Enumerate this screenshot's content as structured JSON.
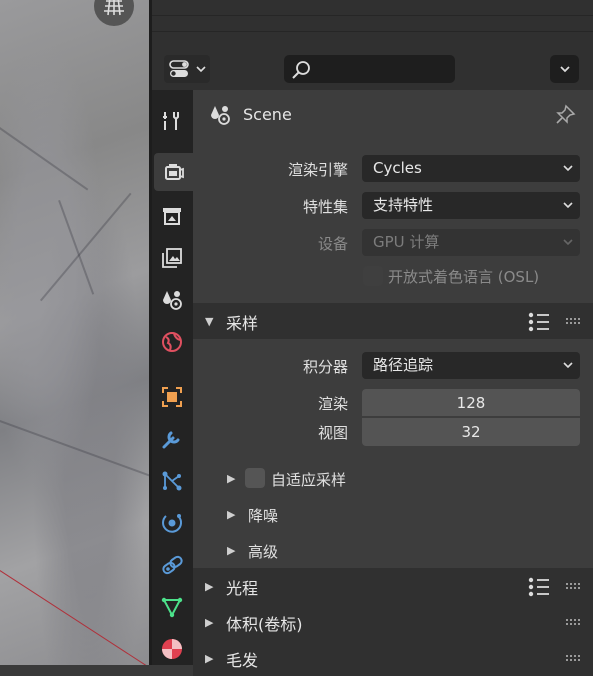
{
  "header": {
    "search_placeholder": ""
  },
  "tabs": [
    {
      "name": "tool",
      "icon": "tool-icon",
      "color": "#dcdcdc"
    },
    {
      "name": "render",
      "icon": "render-icon",
      "color": "#dcdcdc",
      "active": true
    },
    {
      "name": "output",
      "icon": "output-icon",
      "color": "#dcdcdc"
    },
    {
      "name": "view-layer",
      "icon": "view-layer-icon",
      "color": "#dcdcdc"
    },
    {
      "name": "scene",
      "icon": "scene-icon",
      "color": "#dcdcdc"
    },
    {
      "name": "world",
      "icon": "world-icon",
      "color": "#e05060"
    },
    {
      "name": "object",
      "icon": "object-icon",
      "color": "#f0a050"
    },
    {
      "name": "modifiers",
      "icon": "modifier-wrench-icon",
      "color": "#5a9ad8"
    },
    {
      "name": "particles",
      "icon": "particles-icon",
      "color": "#5a9ad8"
    },
    {
      "name": "physics",
      "icon": "physics-icon",
      "color": "#5a9ad8"
    },
    {
      "name": "constraints",
      "icon": "constraints-icon",
      "color": "#5a9ad8"
    },
    {
      "name": "data",
      "icon": "mesh-data-icon",
      "color": "#4ce08a"
    },
    {
      "name": "material",
      "icon": "material-icon",
      "color": "#e04050"
    }
  ],
  "context": {
    "title": "Scene"
  },
  "render": {
    "engine_label": "渲染引擎",
    "engine_value": "Cycles",
    "feature_label": "特性集",
    "feature_value": "支持特性",
    "device_label": "设备",
    "device_value": "GPU 计算",
    "osl_label": "开放式着色语言 (OSL)"
  },
  "sampling": {
    "title": "采样",
    "integrator_label": "积分器",
    "integrator_value": "路径追踪",
    "render_label": "渲染",
    "render_value": "128",
    "viewport_label": "视图",
    "viewport_value": "32",
    "adaptive_label": "自适应采样",
    "denoise_label": "降噪",
    "advanced_label": "高级"
  },
  "panels": {
    "light_paths": "光程",
    "volumes": "体积(卷标)",
    "hair": "毛发"
  }
}
